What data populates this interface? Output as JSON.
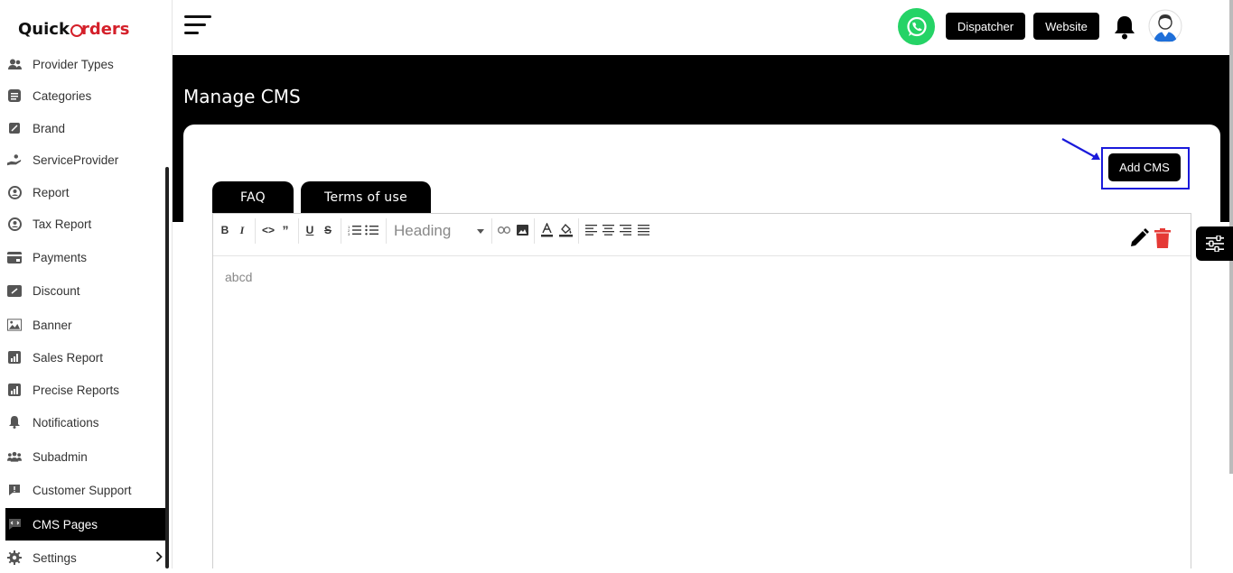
{
  "brand": {
    "part1": "Quick",
    "part2": "rders"
  },
  "sidebar": {
    "items": [
      {
        "label": "Provider Types",
        "icon": "users-icon"
      },
      {
        "label": "Categories",
        "icon": "list-icon"
      },
      {
        "label": "Brand",
        "icon": "tag-icon"
      },
      {
        "label": "ServiceProvider",
        "icon": "hand-icon"
      },
      {
        "label": "Report",
        "icon": "report-icon"
      },
      {
        "label": "Tax Report",
        "icon": "report-icon"
      },
      {
        "label": "Payments",
        "icon": "card-icon"
      },
      {
        "label": "Discount",
        "icon": "discount-icon"
      },
      {
        "label": "Banner",
        "icon": "image-icon"
      },
      {
        "label": "Sales Report",
        "icon": "chart-icon"
      },
      {
        "label": "Precise Reports",
        "icon": "chart-icon"
      },
      {
        "label": "Notifications",
        "icon": "bell-icon"
      },
      {
        "label": "Subadmin",
        "icon": "users-icon"
      },
      {
        "label": "Customer Support",
        "icon": "support-icon"
      },
      {
        "label": "CMS Pages",
        "icon": "cms-icon",
        "active": true
      },
      {
        "label": "Settings",
        "icon": "gear-icon"
      }
    ]
  },
  "topbar": {
    "dispatcher_label": "Dispatcher",
    "website_label": "Website"
  },
  "page": {
    "title": "Manage CMS",
    "add_button": "Add CMS",
    "tabs": [
      "FAQ",
      "Terms of use"
    ],
    "heading_select": "Heading",
    "editor_content": "abcd"
  },
  "colors": {
    "accent": "#000000",
    "brand_red": "#d4202a",
    "whatsapp": "#25d366",
    "highlight": "#1a1adb",
    "delete": "#e53935"
  }
}
